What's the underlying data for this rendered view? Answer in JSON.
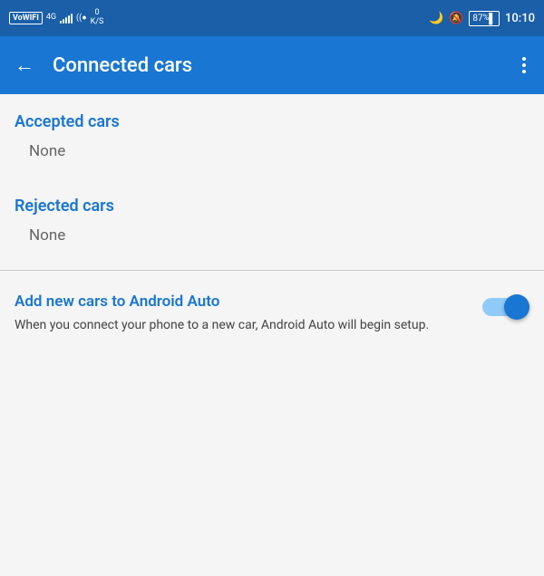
{
  "statusBar": {
    "leftItems": {
      "vowifi": "VoWIFI",
      "network": "4G",
      "signal": "signal",
      "wifi": "wifi",
      "dataSpeed": "0",
      "dataUnit": "K/S"
    },
    "rightItems": {
      "moon": "🌙",
      "bell": "🔔",
      "battery": "87",
      "time": "10:10"
    }
  },
  "appBar": {
    "title": "Connected cars",
    "backLabel": "←",
    "moreLabel": "⋮"
  },
  "sections": {
    "accepted": {
      "title": "Accepted cars",
      "value": "None"
    },
    "rejected": {
      "title": "Rejected cars",
      "value": "None"
    }
  },
  "toggleSection": {
    "title": "Add new cars to Android Auto",
    "description": "When you connect your phone to a new car, Android Auto will begin setup.",
    "enabled": true
  }
}
